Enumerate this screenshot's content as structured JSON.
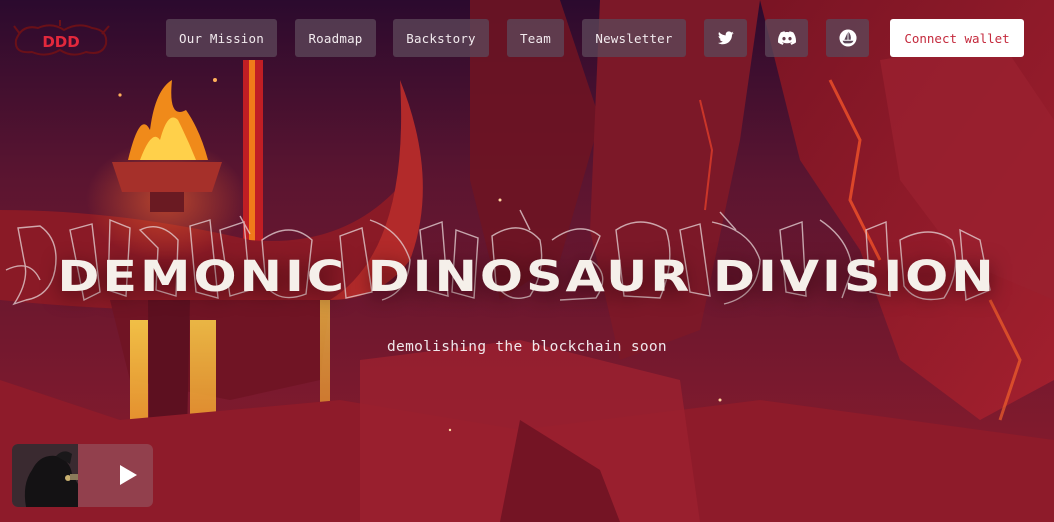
{
  "brand": {
    "logo_text": "DDD",
    "logo_color": "#e3283c"
  },
  "nav": {
    "items": [
      {
        "label": "Our Mission"
      },
      {
        "label": "Roadmap"
      },
      {
        "label": "Backstory"
      },
      {
        "label": "Team"
      },
      {
        "label": "Newsletter"
      }
    ],
    "social": [
      {
        "icon": "twitter-icon"
      },
      {
        "icon": "discord-icon"
      },
      {
        "icon": "opensea-icon"
      }
    ],
    "connect_label": "Connect wallet"
  },
  "hero": {
    "title": "DEMONIC DINOSAUR DIVISION",
    "subtitle": "demolishing the blockchain soon"
  },
  "player": {
    "icon": "play-icon"
  },
  "colors": {
    "background": "#5a1220",
    "accent": "#c42a3d",
    "nav_button": "#5c4658",
    "lava": "#f0a21a"
  }
}
